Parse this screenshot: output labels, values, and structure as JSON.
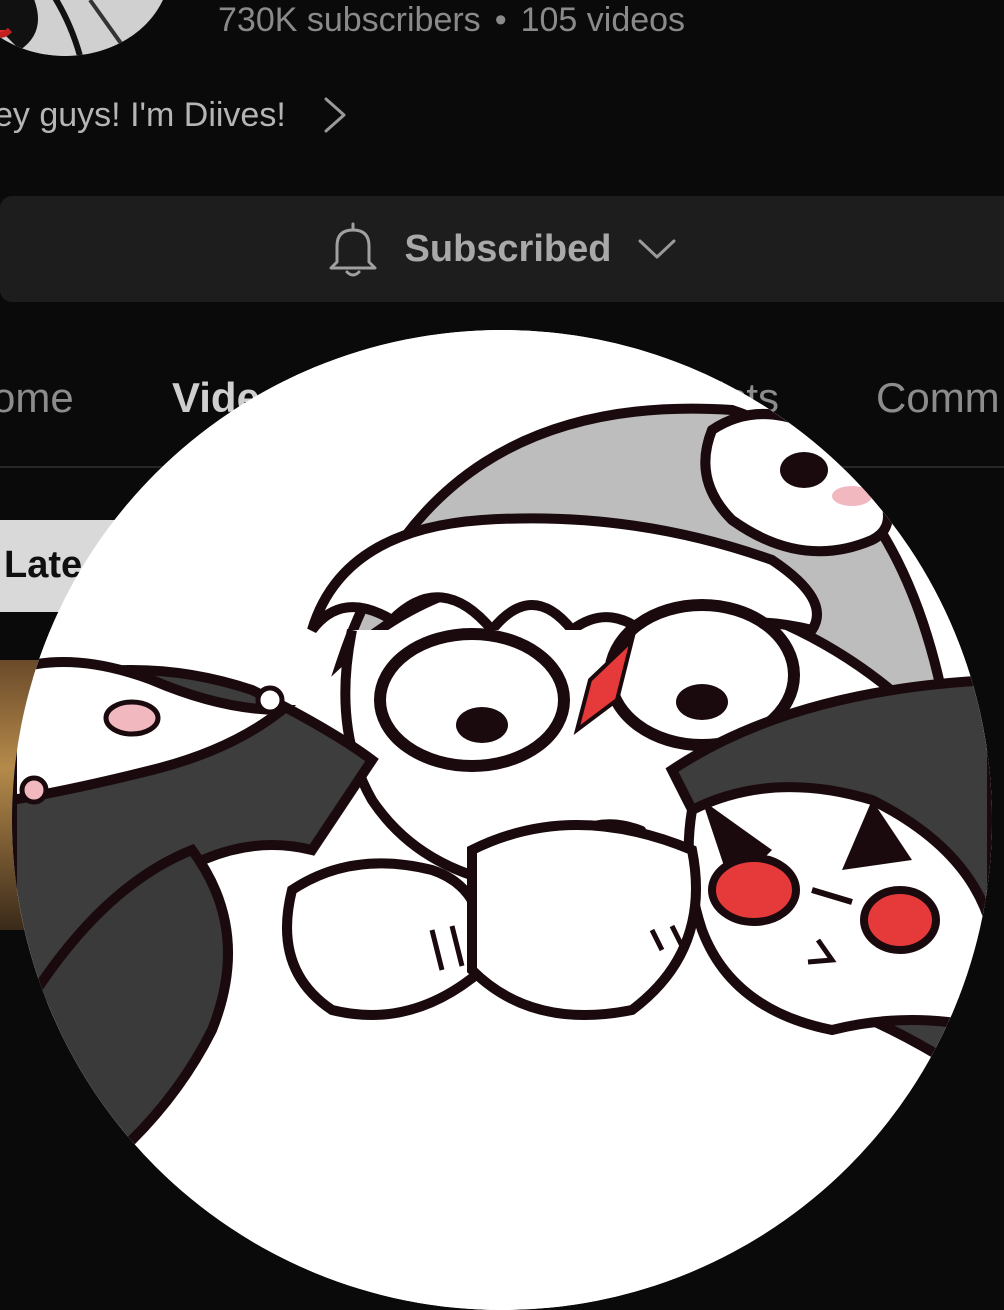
{
  "channel": {
    "subscribers": "730K subscribers",
    "separator": "•",
    "videos": "105 videos",
    "description": "ey guys! I'm Diives!"
  },
  "subscribe_button": {
    "label": "Subscribed"
  },
  "tabs": [
    {
      "label": "ome"
    },
    {
      "label": "Vide"
    },
    {
      "label": "ists"
    },
    {
      "label": "Comm"
    }
  ],
  "filter_chip": {
    "label": "Late"
  },
  "icons": {
    "notification": "bell-icon",
    "dropdown": "chevron-down-icon",
    "more": "chevron-right-icon"
  },
  "colors": {
    "background": "#0a0a0a",
    "button_bg": "#1d1d1d",
    "chip_bg": "#d9d9d9",
    "accent_red": "#e63a3a"
  }
}
